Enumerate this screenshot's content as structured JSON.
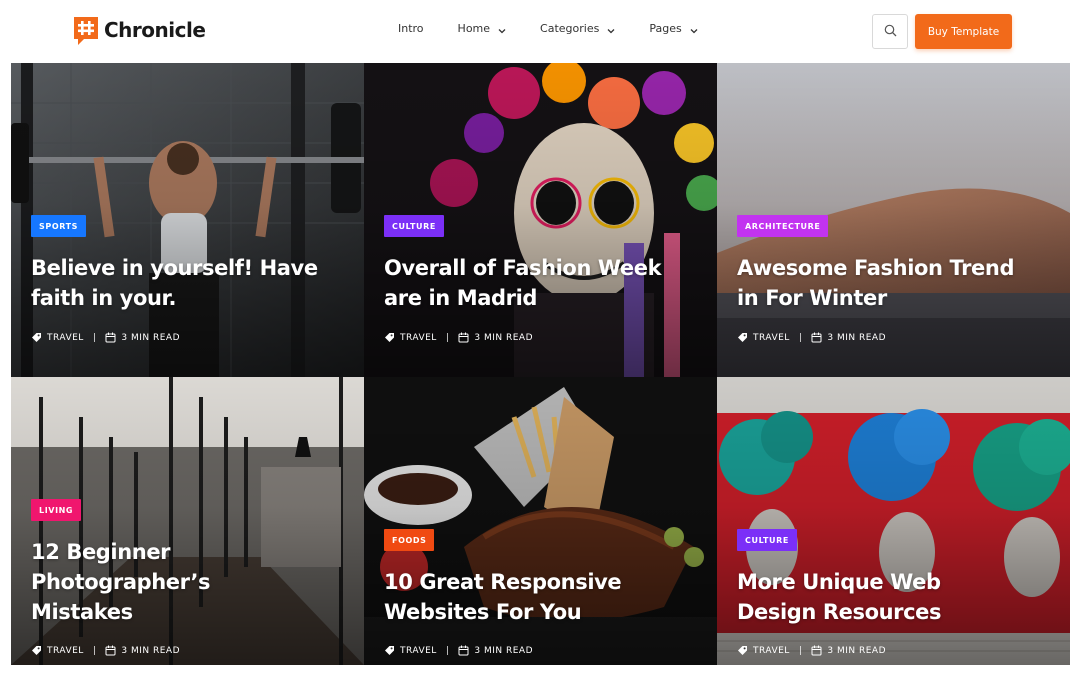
{
  "brand": {
    "name": "Chronicle",
    "accent": "#f26a1a"
  },
  "nav": {
    "items": [
      {
        "label": "Intro",
        "has_dropdown": false
      },
      {
        "label": "Home",
        "has_dropdown": true
      },
      {
        "label": "Categories",
        "has_dropdown": true
      },
      {
        "label": "Pages",
        "has_dropdown": true
      }
    ],
    "search_icon": "search-icon",
    "buy_label": "Buy Template"
  },
  "posts": [
    {
      "category": "SPORTS",
      "category_color": "#1677ff",
      "title": "Believe in yourself! Have faith in your.",
      "tag": "TRAVEL",
      "read": "3 MIN READ",
      "image": "woman-barbell-gym"
    },
    {
      "category": "CULTURE",
      "category_color": "#7b2ff7",
      "title": "Overall of Fashion Week are in Madrid",
      "tag": "TRAVEL",
      "read": "3 MIN READ",
      "image": "sugar-skull-flower-crown"
    },
    {
      "category": "ARCHITECTURE",
      "category_color": "#c233f0",
      "title": "Awesome Fashion Trend in For Winter",
      "tag": "TRAVEL",
      "read": "3 MIN READ",
      "image": "sand-dune-waterfront"
    },
    {
      "category": "LIVING",
      "category_color": "#f0166e",
      "title": "12 Beginner Photographer’s Mistakes",
      "tag": "TRAVEL",
      "read": "3 MIN READ",
      "image": "glass-office-corridor"
    },
    {
      "category": "FOODS",
      "category_color": "#f04a12",
      "title": "10 Great Responsive Websites For You",
      "tag": "TRAVEL",
      "read": "3 MIN READ",
      "image": "ribs-fries-plate"
    },
    {
      "category": "CULTURE",
      "category_color": "#7b2ff7",
      "title": "More Unique Web Design Resources",
      "tag": "TRAVEL",
      "read": "3 MIN READ",
      "image": "street-art-mural"
    }
  ]
}
